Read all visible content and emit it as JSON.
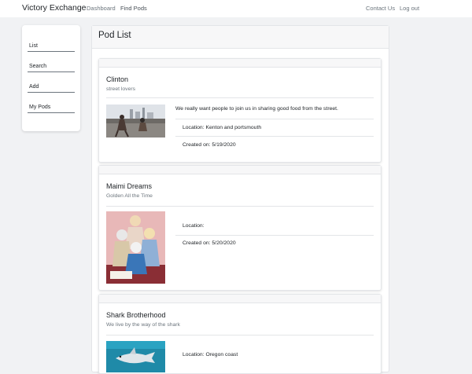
{
  "nav": {
    "brand": "Victory Exchange",
    "links": [
      "Dashboard",
      "Find Pods"
    ],
    "right_links": [
      "Contact Us",
      "Log out"
    ]
  },
  "sidebar": {
    "items": [
      {
        "label": "List"
      },
      {
        "label": "Search"
      },
      {
        "label": "Add"
      },
      {
        "label": "My Pods"
      }
    ]
  },
  "main": {
    "title": "Pod List"
  },
  "pods": [
    {
      "name": "Clinton",
      "tagline": "street lovers",
      "description": "We really want people to join us in sharing good food from the street.",
      "location": "Location: Kenton and portsmouth",
      "created": "Created on: 5/19/2020",
      "image_icon": "street-photo-icon"
    },
    {
      "name": "Maimi Dreams",
      "tagline": "Golden All the Time",
      "description": "",
      "location": "Location:",
      "created": "Created on: 5/20/2020",
      "image_icon": "group-photo-icon"
    },
    {
      "name": "Shark Brotherhood",
      "tagline": "We live by the way of the shark",
      "description": "",
      "location": "Location: Oregon coast",
      "created": "",
      "image_icon": "shark-photo-icon"
    }
  ]
}
